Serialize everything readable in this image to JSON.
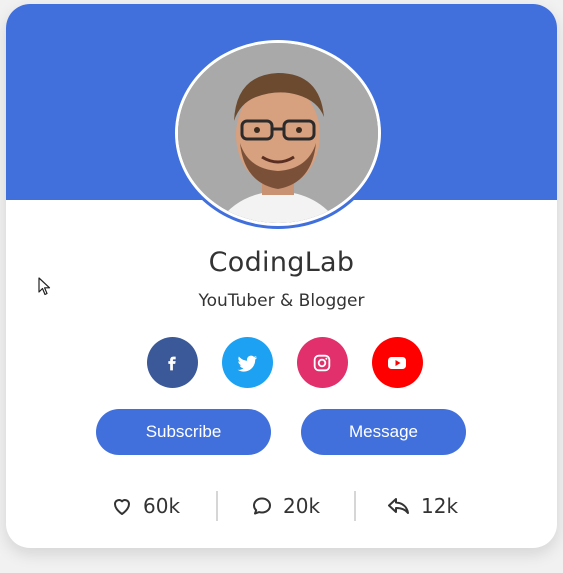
{
  "profile": {
    "name": "CodingLab",
    "role": "YouTuber & Blogger"
  },
  "socials": [
    {
      "icon": "facebook-icon",
      "color": "#3b5998"
    },
    {
      "icon": "twitter-icon",
      "color": "#1da1f2"
    },
    {
      "icon": "instagram-icon",
      "color": "#e1306c"
    },
    {
      "icon": "youtube-icon",
      "color": "#ff0000"
    }
  ],
  "buttons": {
    "subscribe": "Subscribe",
    "message": "Message"
  },
  "stats": {
    "likes": "60k",
    "comments": "20k",
    "shares": "12k"
  },
  "colors": {
    "accent": "#4170dc",
    "text": "#333333"
  }
}
